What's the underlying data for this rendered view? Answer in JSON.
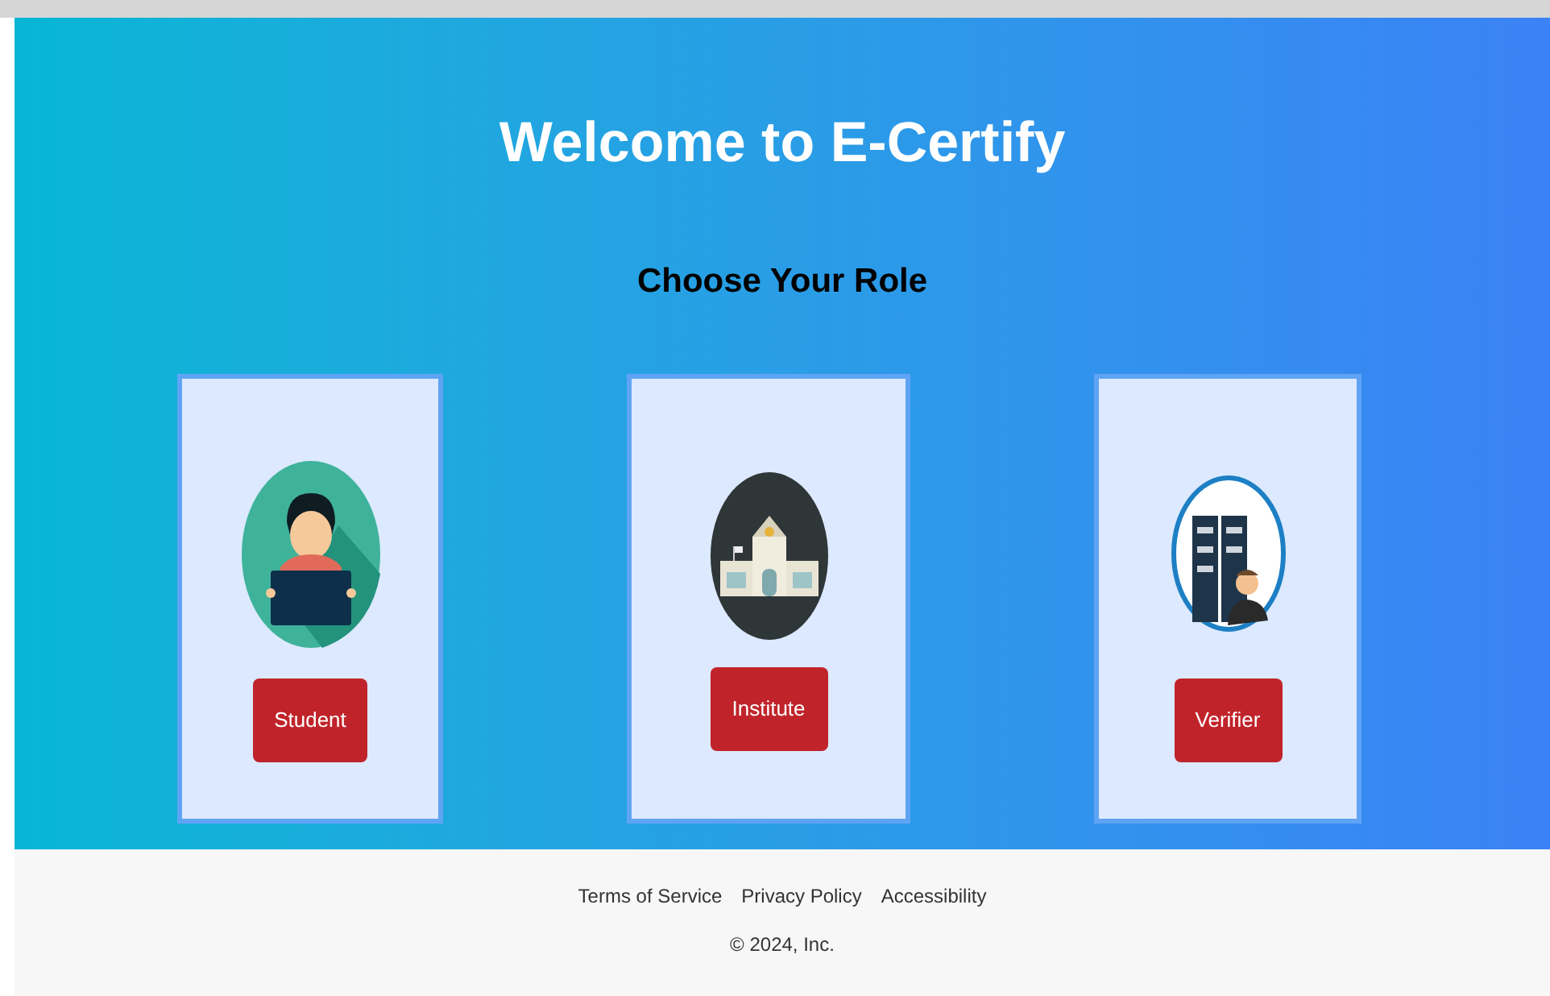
{
  "header": {
    "title": "Welcome to E-Certify",
    "subtitle": "Choose Your Role"
  },
  "roles": [
    {
      "kind": "student",
      "label": "Student"
    },
    {
      "kind": "institute",
      "label": "Institute"
    },
    {
      "kind": "verifier",
      "label": "Verifier"
    }
  ],
  "footer": {
    "links": [
      "Terms of Service",
      "Privacy Policy",
      "Accessibility"
    ],
    "copyright": "© 2024, Inc."
  }
}
